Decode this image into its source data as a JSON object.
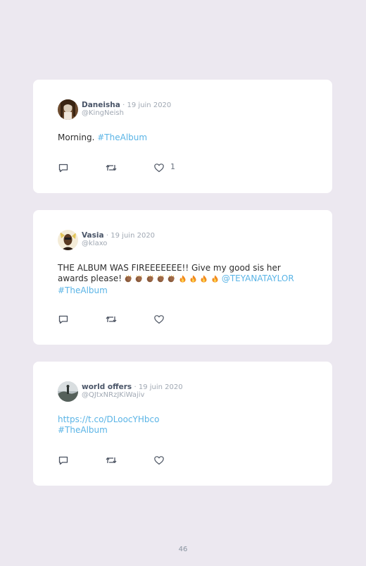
{
  "tweets": [
    {
      "author": "Daneisha",
      "date": "· 19 juin 2020",
      "handle": "@KingNeish",
      "text": "Morning.",
      "hashtag": "#TheAlbum",
      "likes": "1"
    },
    {
      "author": "Vasia",
      "date": "· 19 juin 2020",
      "handle": "@klaxo",
      "text": "THE ALBUM WAS FIREEEEEEE!! Give my good sis her awards please!",
      "emojis": "5x clapping-hands-medium-dark-skin, 4x fire",
      "mention": "@TEYANATAYLOR",
      "hashtag": "#TheAlbum"
    },
    {
      "author": "world offers",
      "date": "· 19 juin 2020",
      "handle": "@QJtxNRzJKiWajiv",
      "link": "https://t.co/DLoocYHbco",
      "hashtag": "#TheAlbum"
    }
  ],
  "icons": {
    "reply": "reply-icon",
    "retweet": "retweet-icon",
    "like": "heart-icon"
  },
  "colors": {
    "background": "#ece8f0",
    "card": "#ffffff",
    "link": "#5ab4e6"
  },
  "page_number": "46"
}
